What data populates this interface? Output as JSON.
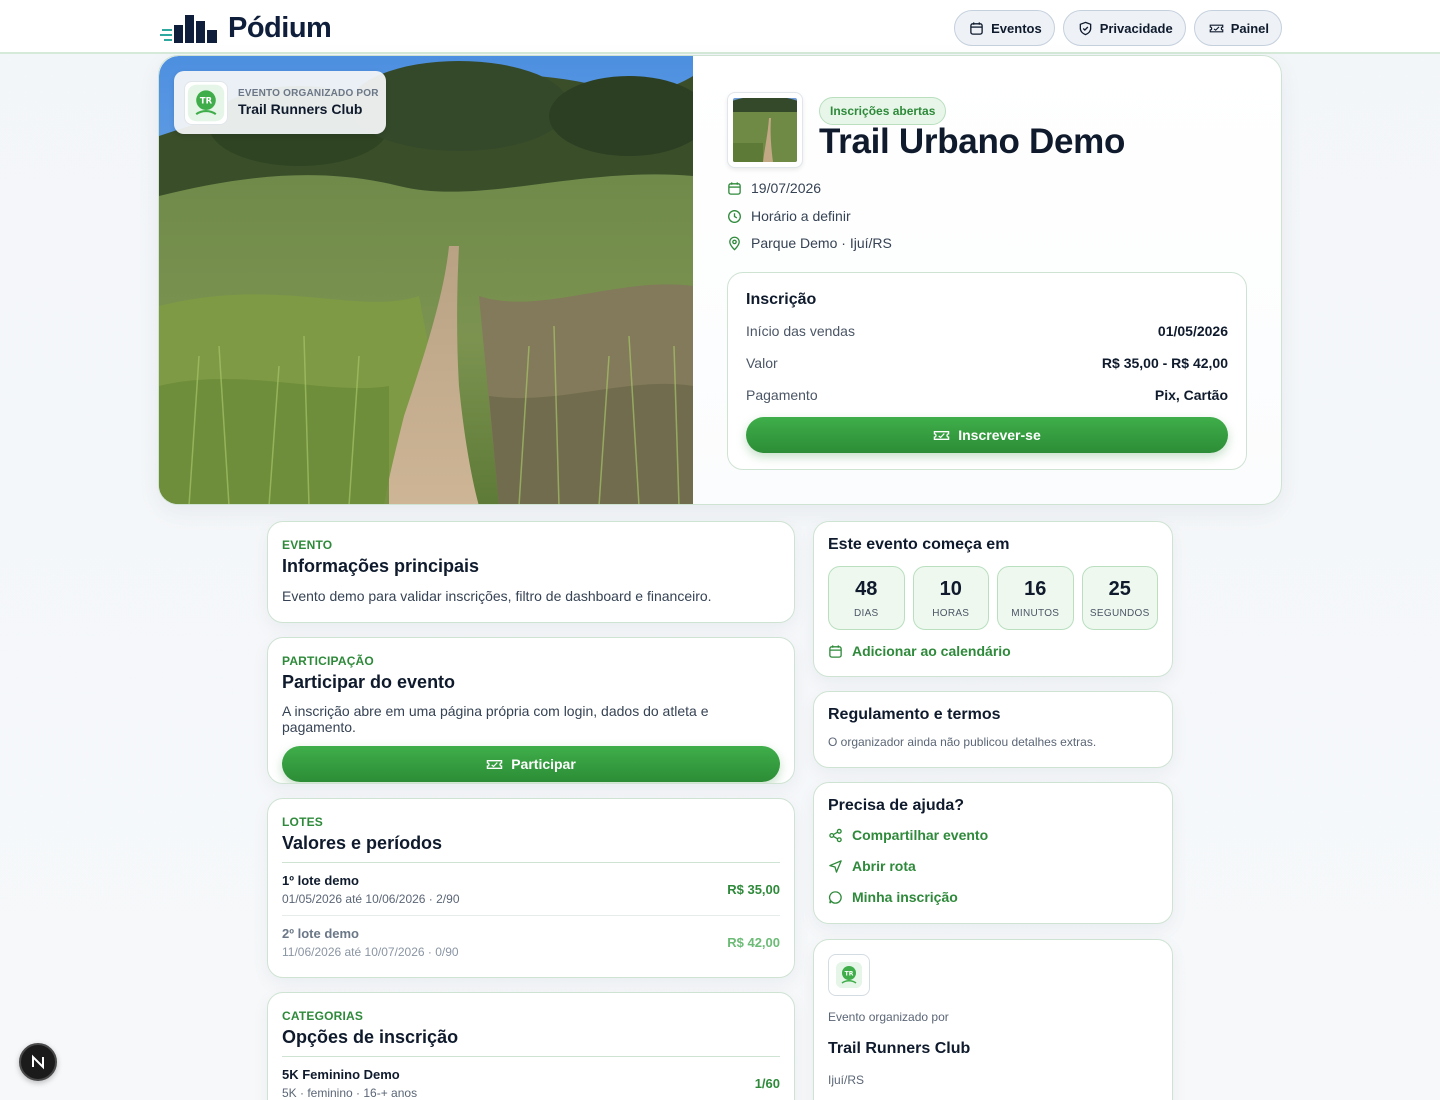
{
  "brand": {
    "name": "Pódium"
  },
  "nav": {
    "events": "Eventos",
    "privacy": "Privacidade",
    "panel": "Painel"
  },
  "hero": {
    "organizer_kicker": "EVENTO ORGANIZADO POR",
    "organizer_name": "Trail Runners Club",
    "status": "Inscrições abertas",
    "title": "Trail Urbano Demo",
    "date": "19/07/2026",
    "time": "Horário a definir",
    "location": "Parque Demo · Ijuí/RS"
  },
  "registration": {
    "title": "Inscrição",
    "sales_start_label": "Início das vendas",
    "sales_start_value": "01/05/2026",
    "price_label": "Valor",
    "price_value": "R$ 35,00 - R$ 42,00",
    "payment_label": "Pagamento",
    "payment_value": "Pix, Cartão",
    "cta": "Inscrever-se"
  },
  "info_card": {
    "kicker": "EVENTO",
    "title": "Informações principais",
    "text": "Evento demo para validar inscrições, filtro de dashboard e financeiro."
  },
  "participation_card": {
    "kicker": "PARTICIPAÇÃO",
    "title": "Participar do evento",
    "text": "A inscrição abre em uma página própria com login, dados do atleta e pagamento.",
    "cta": "Participar"
  },
  "lots_card": {
    "kicker": "LOTES",
    "title": "Valores e períodos",
    "lots": [
      {
        "name": "1º lote demo",
        "detail": "01/05/2026 até 10/06/2026 · 2/90",
        "price": "R$ 35,00"
      },
      {
        "name": "2º lote demo",
        "detail": "11/06/2026 até 10/07/2026 · 0/90",
        "price": "R$ 42,00"
      }
    ]
  },
  "categories_card": {
    "kicker": "CATEGORIAS",
    "title": "Opções de inscrição",
    "items": [
      {
        "name": "5K Feminino Demo",
        "detail": "5K · feminino · 16-+ anos",
        "count": "1/60"
      }
    ]
  },
  "countdown": {
    "title": "Este evento começa em",
    "units": [
      {
        "value": "48",
        "label": "DIAS"
      },
      {
        "value": "10",
        "label": "HORAS"
      },
      {
        "value": "16",
        "label": "MINUTOS"
      },
      {
        "value": "25",
        "label": "SEGUNDOS"
      }
    ],
    "calendar_link": "Adicionar ao calendário"
  },
  "rules_card": {
    "title": "Regulamento e termos",
    "text": "O organizador ainda não publicou detalhes extras."
  },
  "help_card": {
    "title": "Precisa de ajuda?",
    "share": "Compartilhar evento",
    "route": "Abrir rota",
    "my_registration": "Minha inscrição"
  },
  "organizer_card": {
    "kicker": "Evento organizado por",
    "name": "Trail Runners Club",
    "city": "Ijuí/RS"
  },
  "fab": {
    "label": "N"
  },
  "colors": {
    "accent": "#2e8a3a",
    "accent_light": "#e8f6ea",
    "text": "#0f1b2d",
    "border": "#cfe3d3"
  }
}
